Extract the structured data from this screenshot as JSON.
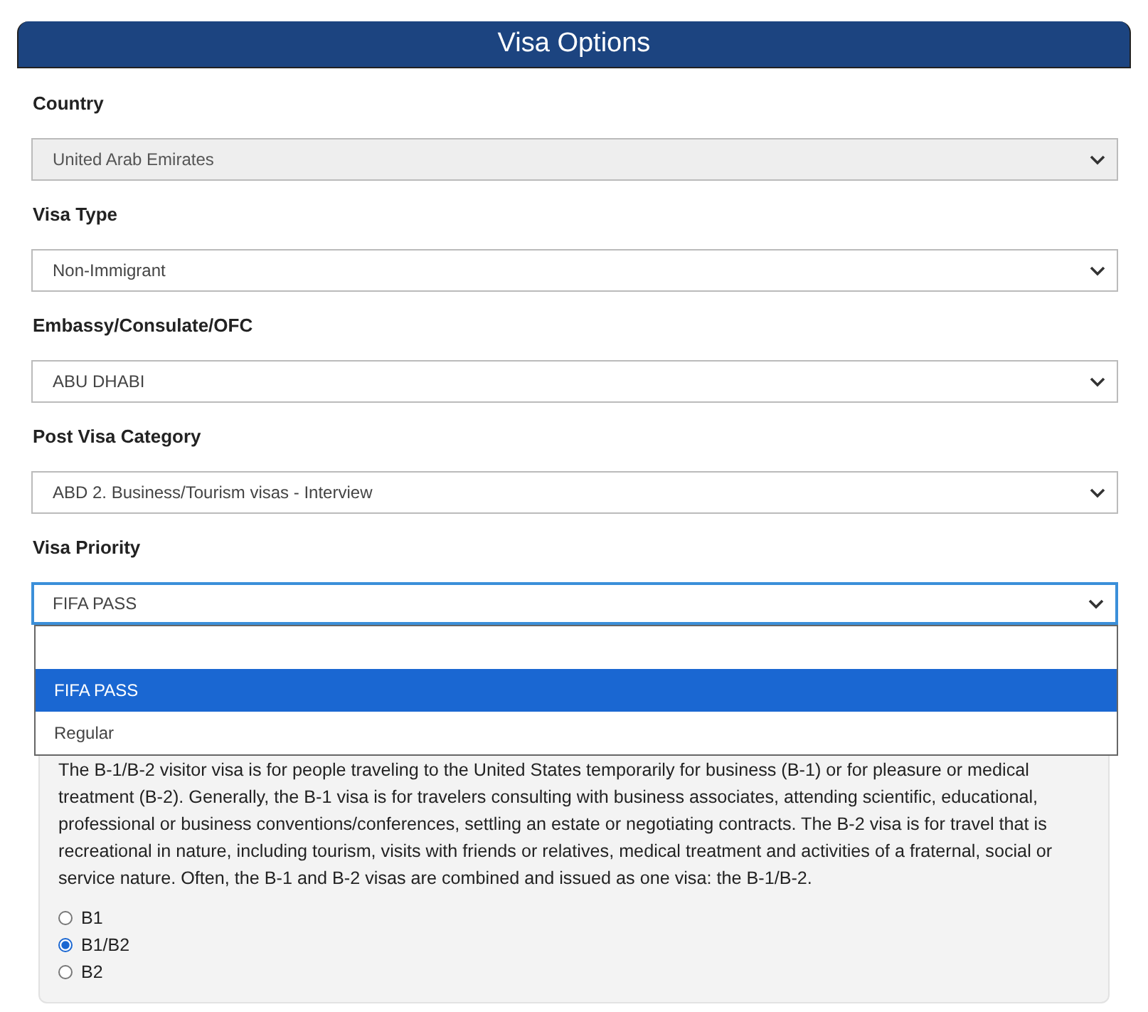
{
  "header": {
    "title": "Visa Options"
  },
  "fields": [
    {
      "label": "Country",
      "value": "United Arab Emirates",
      "disabled": true,
      "focused": false
    },
    {
      "label": "Visa Type",
      "value": "Non-Immigrant",
      "disabled": false,
      "focused": false
    },
    {
      "label": "Embassy/Consulate/OFC",
      "value": "ABU DHABI",
      "disabled": false,
      "focused": false
    },
    {
      "label": "Post Visa Category",
      "value": "ABD 2. Business/Tourism visas - Interview",
      "disabled": false,
      "focused": false
    },
    {
      "label": "Visa Priority",
      "value": "FIFA PASS",
      "disabled": false,
      "focused": true,
      "options": [
        {
          "selected": false
        },
        {
          "label": "FIFA PASS",
          "selected": true
        },
        {
          "label": "Regular",
          "selected": false
        }
      ]
    }
  ],
  "info_panel": {
    "text": "The B-1/B-2 visitor visa is for people traveling to the United States temporarily for business (B-1) or for pleasure or medical treatment (B-2). Generally, the B-1 visa is for travelers consulting with business associates, attending scientific, educational, professional or business conventions/conferences, settling an estate or negotiating contracts. The B-2 visa is for travel that is recreational in nature, including tourism, visits with friends or relatives, medical treatment and activities of a fraternal, social or service nature. Often, the B-1 and B-2 visas are combined and issued as one visa: the B-1/B-2.",
    "radios": [
      {
        "label": "B1",
        "selected": false
      },
      {
        "label": "B1/B2",
        "selected": true
      },
      {
        "label": "B2",
        "selected": false
      }
    ]
  }
}
